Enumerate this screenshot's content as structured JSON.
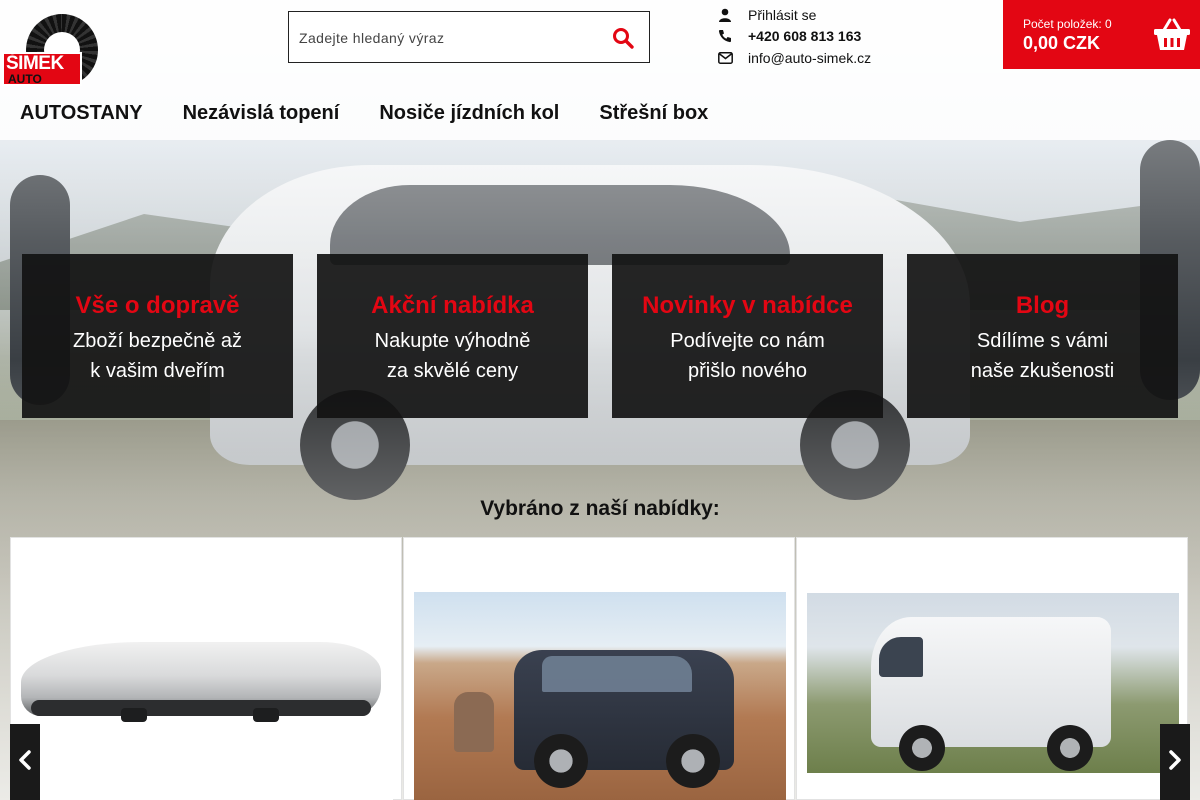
{
  "header": {
    "logo": {
      "brand": "ŠIMEK",
      "sub": "AUTO"
    },
    "search": {
      "placeholder": "Zadejte hledaný výraz"
    },
    "contact": {
      "login": "Přihlásit se",
      "phone": "+420 608 813 163",
      "email": "info@auto-simek.cz"
    },
    "cart": {
      "count_label": "Počet položek: 0",
      "price": "0,00 CZK"
    }
  },
  "nav": {
    "items": [
      {
        "label": "AUTOSTANY"
      },
      {
        "label": "Nezávislá topení"
      },
      {
        "label": "Nosiče jízdních kol"
      },
      {
        "label": "Střešní box"
      }
    ]
  },
  "tiles": [
    {
      "title": "Vše o dopravě",
      "line1": "Zboží bezpečně až",
      "line2": "k vašim dveřím"
    },
    {
      "title": "Akční nabídka",
      "line1": "Nakupte výhodně",
      "line2": "za skvělé ceny"
    },
    {
      "title": "Novinky v nabídce",
      "line1": "Podívejte co nám",
      "line2": "přišlo nového"
    },
    {
      "title": "Blog",
      "line1": "Sdílíme s vámi",
      "line2": "naše zkušenosti"
    }
  ],
  "section": {
    "title": "Vybráno z naší nabídky:"
  },
  "colors": {
    "accent": "#e30613",
    "tile_bg": "#121212",
    "text": "#111111"
  },
  "icons": {
    "search": "search-icon",
    "login": "user-icon",
    "phone": "phone-icon",
    "email": "envelope-icon",
    "cart": "basket-icon",
    "prev": "chevron-left-icon",
    "next": "chevron-right-icon"
  }
}
